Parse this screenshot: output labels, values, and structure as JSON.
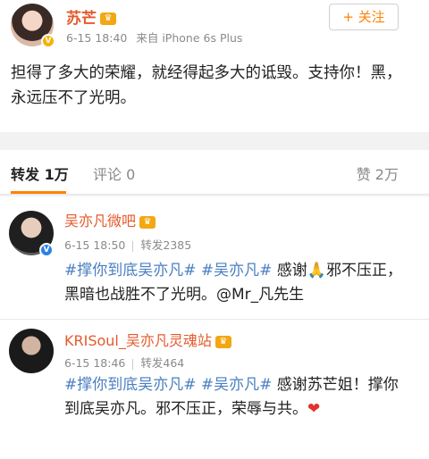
{
  "post": {
    "author": "苏芒",
    "time": "6-15 18:40",
    "source": "来自 iPhone 6s Plus",
    "follow_label": "+ 关注",
    "text": "担得了多大的荣耀，就经得起多大的诋毁。支持你！黑，永远压不了光明。"
  },
  "tabs": {
    "repost": "转发 1万",
    "comment": "评论 0",
    "like": "赞 2万"
  },
  "reposts": [
    {
      "name": "吴亦凡微吧",
      "time": "6-15 18:50",
      "repost_count": "转发2385",
      "topic1": "#撑你到底吴亦凡#",
      "topic2": "#吴亦凡#",
      "text_a": " 感谢",
      "emoji": "🙏",
      "text_b": "邪不压正，黑暗也战胜不了光明。@Mr_凡先生"
    },
    {
      "name": "KRISoul_吴亦凡灵魂站",
      "time": "6-15 18:46",
      "repost_count": "转发464",
      "topic1": "#撑你到底吴亦凡#",
      "topic2": "#吴亦凡#",
      "text_a": " 感谢苏芒姐！撑你到底吴亦凡。邪不压正，荣辱与共。",
      "emoji": "❤"
    }
  ],
  "colors": {
    "name": "#e45a2b",
    "topic": "#4a7fc1",
    "accent": "#ff8200"
  },
  "icons": {
    "member_crown": "crown-icon",
    "verified": "verified-badge-icon"
  }
}
